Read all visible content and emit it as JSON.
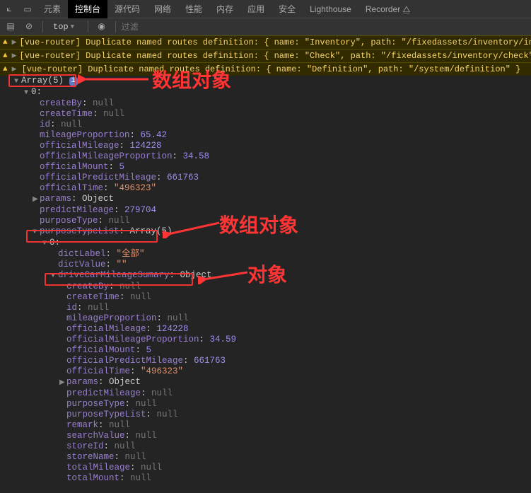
{
  "tabs": {
    "inspect_icon": "⟀",
    "device_icon": "▭",
    "items": [
      "元素",
      "控制台",
      "源代码",
      "网络",
      "性能",
      "内存",
      "应用",
      "安全",
      "Lighthouse",
      "Recorder ⧋"
    ],
    "active_index": 1
  },
  "toolbar": {
    "clear_icon": "⊘",
    "context": "top",
    "eye_icon": "◉",
    "filter_placeholder": "过滤"
  },
  "warnings": [
    "[vue-router] Duplicate named routes definition: { name: \"Inventory\", path: \"/fixedassets/inventory/inventory\" }",
    "[vue-router] Duplicate named routes definition: { name: \"Check\", path: \"/fixedassets/inventory/check\" }",
    "[vue-router] Duplicate named routes definition: { name: \"Definition\", path: \"/system/definition\" }"
  ],
  "root_label": "Array(5)",
  "info_badge": "i",
  "idx0_label": "0:",
  "obj1": {
    "createBy": "null",
    "createTime": "null",
    "id": "null",
    "mileageProportion": "65.42",
    "officialMileage": "124228",
    "officialMileageProportion": "34.58",
    "officialMount": "5",
    "officialPredictMileage": "661763",
    "officialTime": "\"496323\"",
    "params_label": "params",
    "params_val": "Object",
    "predictMileage": "279704",
    "purposeType": "null"
  },
  "ptl_key": "purposeTypeList",
  "ptl_val": "Array(5)",
  "inner_idx0": "0:",
  "inner0": {
    "dictLabel": "\"全部\"",
    "dictValue": "\"\""
  },
  "dcms_key": "driveCarMileageSumary",
  "dcms_val": "Object",
  "obj2": {
    "createBy": "null",
    "createTime": "null",
    "id": "null",
    "mileageProportion": "null",
    "officialMileage": "124228",
    "officialMileageProportion": "34.59",
    "officialMount": "5",
    "officialPredictMileage": "661763",
    "officialTime": "\"496323\"",
    "params_label": "params",
    "params_val": "Object",
    "predictMileage": "null",
    "purposeType": "null",
    "purposeTypeList": "null",
    "remark": "null",
    "searchValue": "null",
    "storeId": "null",
    "storeName": "null",
    "totalMileage": "null",
    "totalMount": "null"
  },
  "annotations": {
    "a1": "数组对象",
    "a2": "数组对象",
    "a3": "对象"
  }
}
